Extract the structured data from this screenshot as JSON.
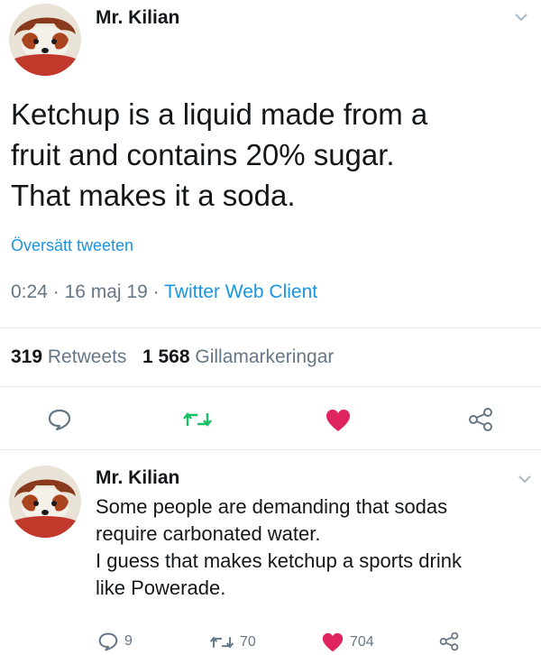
{
  "tweet": {
    "author": "Mr. Kilian",
    "text_lines": [
      "Ketchup is a liquid made from a",
      "fruit and contains 20% sugar.",
      "That makes it a soda."
    ],
    "translate_label": "Översätt tweeten",
    "time": "0:24",
    "date": "16 maj 19",
    "separator": "·",
    "client": "Twitter Web Client",
    "retweets_count": "319",
    "retweets_label": "Retweets",
    "likes_count": "1 568",
    "likes_label": "Gillamarkeringar"
  },
  "reply": {
    "author": "Mr. Kilian",
    "text_lines": [
      "Some people are demanding that sodas",
      "require carbonated water.",
      "I guess that makes ketchup a sports drink",
      "like Powerade."
    ],
    "reply_count": "9",
    "retweet_count": "70",
    "like_count": "704"
  },
  "icons": {
    "reply": "speech-bubble-icon",
    "retweet": "retweet-arrows-icon",
    "like": "heart-icon",
    "share": "share-icon",
    "menu": "chevron-down-icon"
  },
  "colors": {
    "link": "#1b95e0",
    "retweet": "#17bf63",
    "like": "#e0245e",
    "muted": "#657786",
    "text": "#14171a"
  }
}
